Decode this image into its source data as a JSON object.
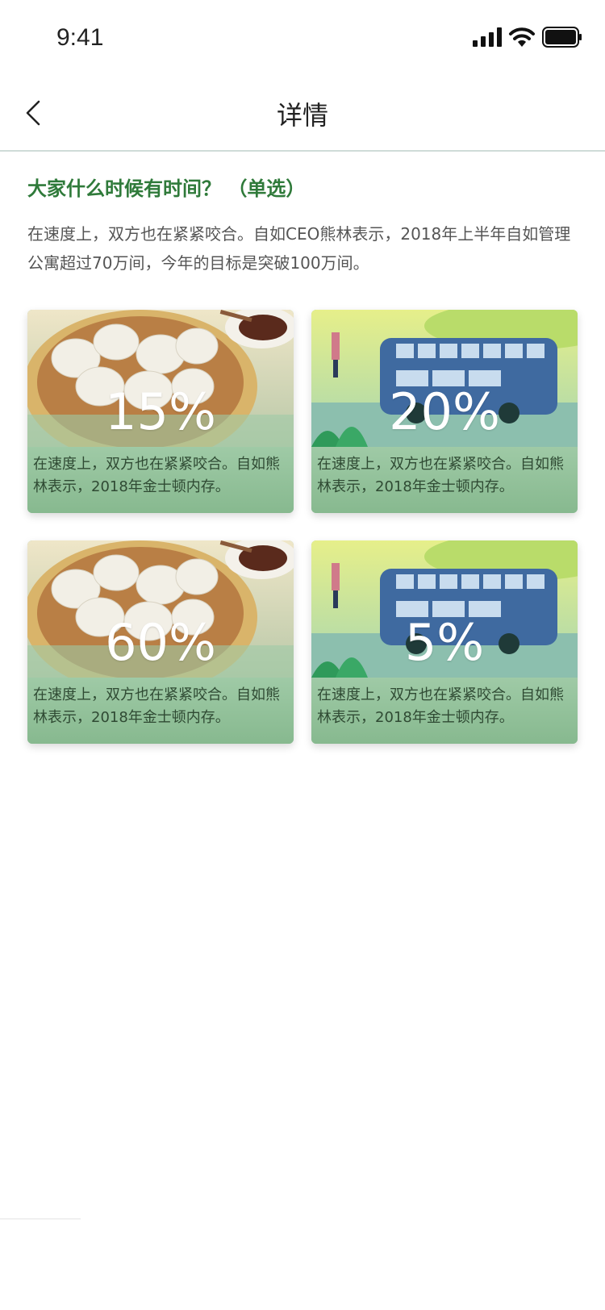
{
  "status_bar": {
    "time": "9:41"
  },
  "nav": {
    "title": "详情"
  },
  "question": {
    "title": "大家什么时候有时间？  （单选）",
    "description": "在速度上，双方也在紧紧咬合。自如CEO熊林表示，2018年上半年自如管理公寓超过70万间，今年的目标是突破100万间。"
  },
  "options": [
    {
      "percent": "15%",
      "caption": "在速度上，双方也在紧紧咬合。自如熊林表示，2018年金士顿内存。",
      "image": "dumplings"
    },
    {
      "percent": "20%",
      "caption": "在速度上，双方也在紧紧咬合。自如熊林表示，2018年金士顿内存。",
      "image": "bus"
    },
    {
      "percent": "60%",
      "caption": "在速度上，双方也在紧紧咬合。自如熊林表示，2018年金士顿内存。",
      "image": "dumplings"
    },
    {
      "percent": "5%",
      "caption": "在速度上，双方也在紧紧咬合。自如熊林表示，2018年金士顿内存。",
      "image": "bus"
    }
  ],
  "colors": {
    "accent_green": "#2f7a3a",
    "caption_green": "#8fbf98"
  }
}
